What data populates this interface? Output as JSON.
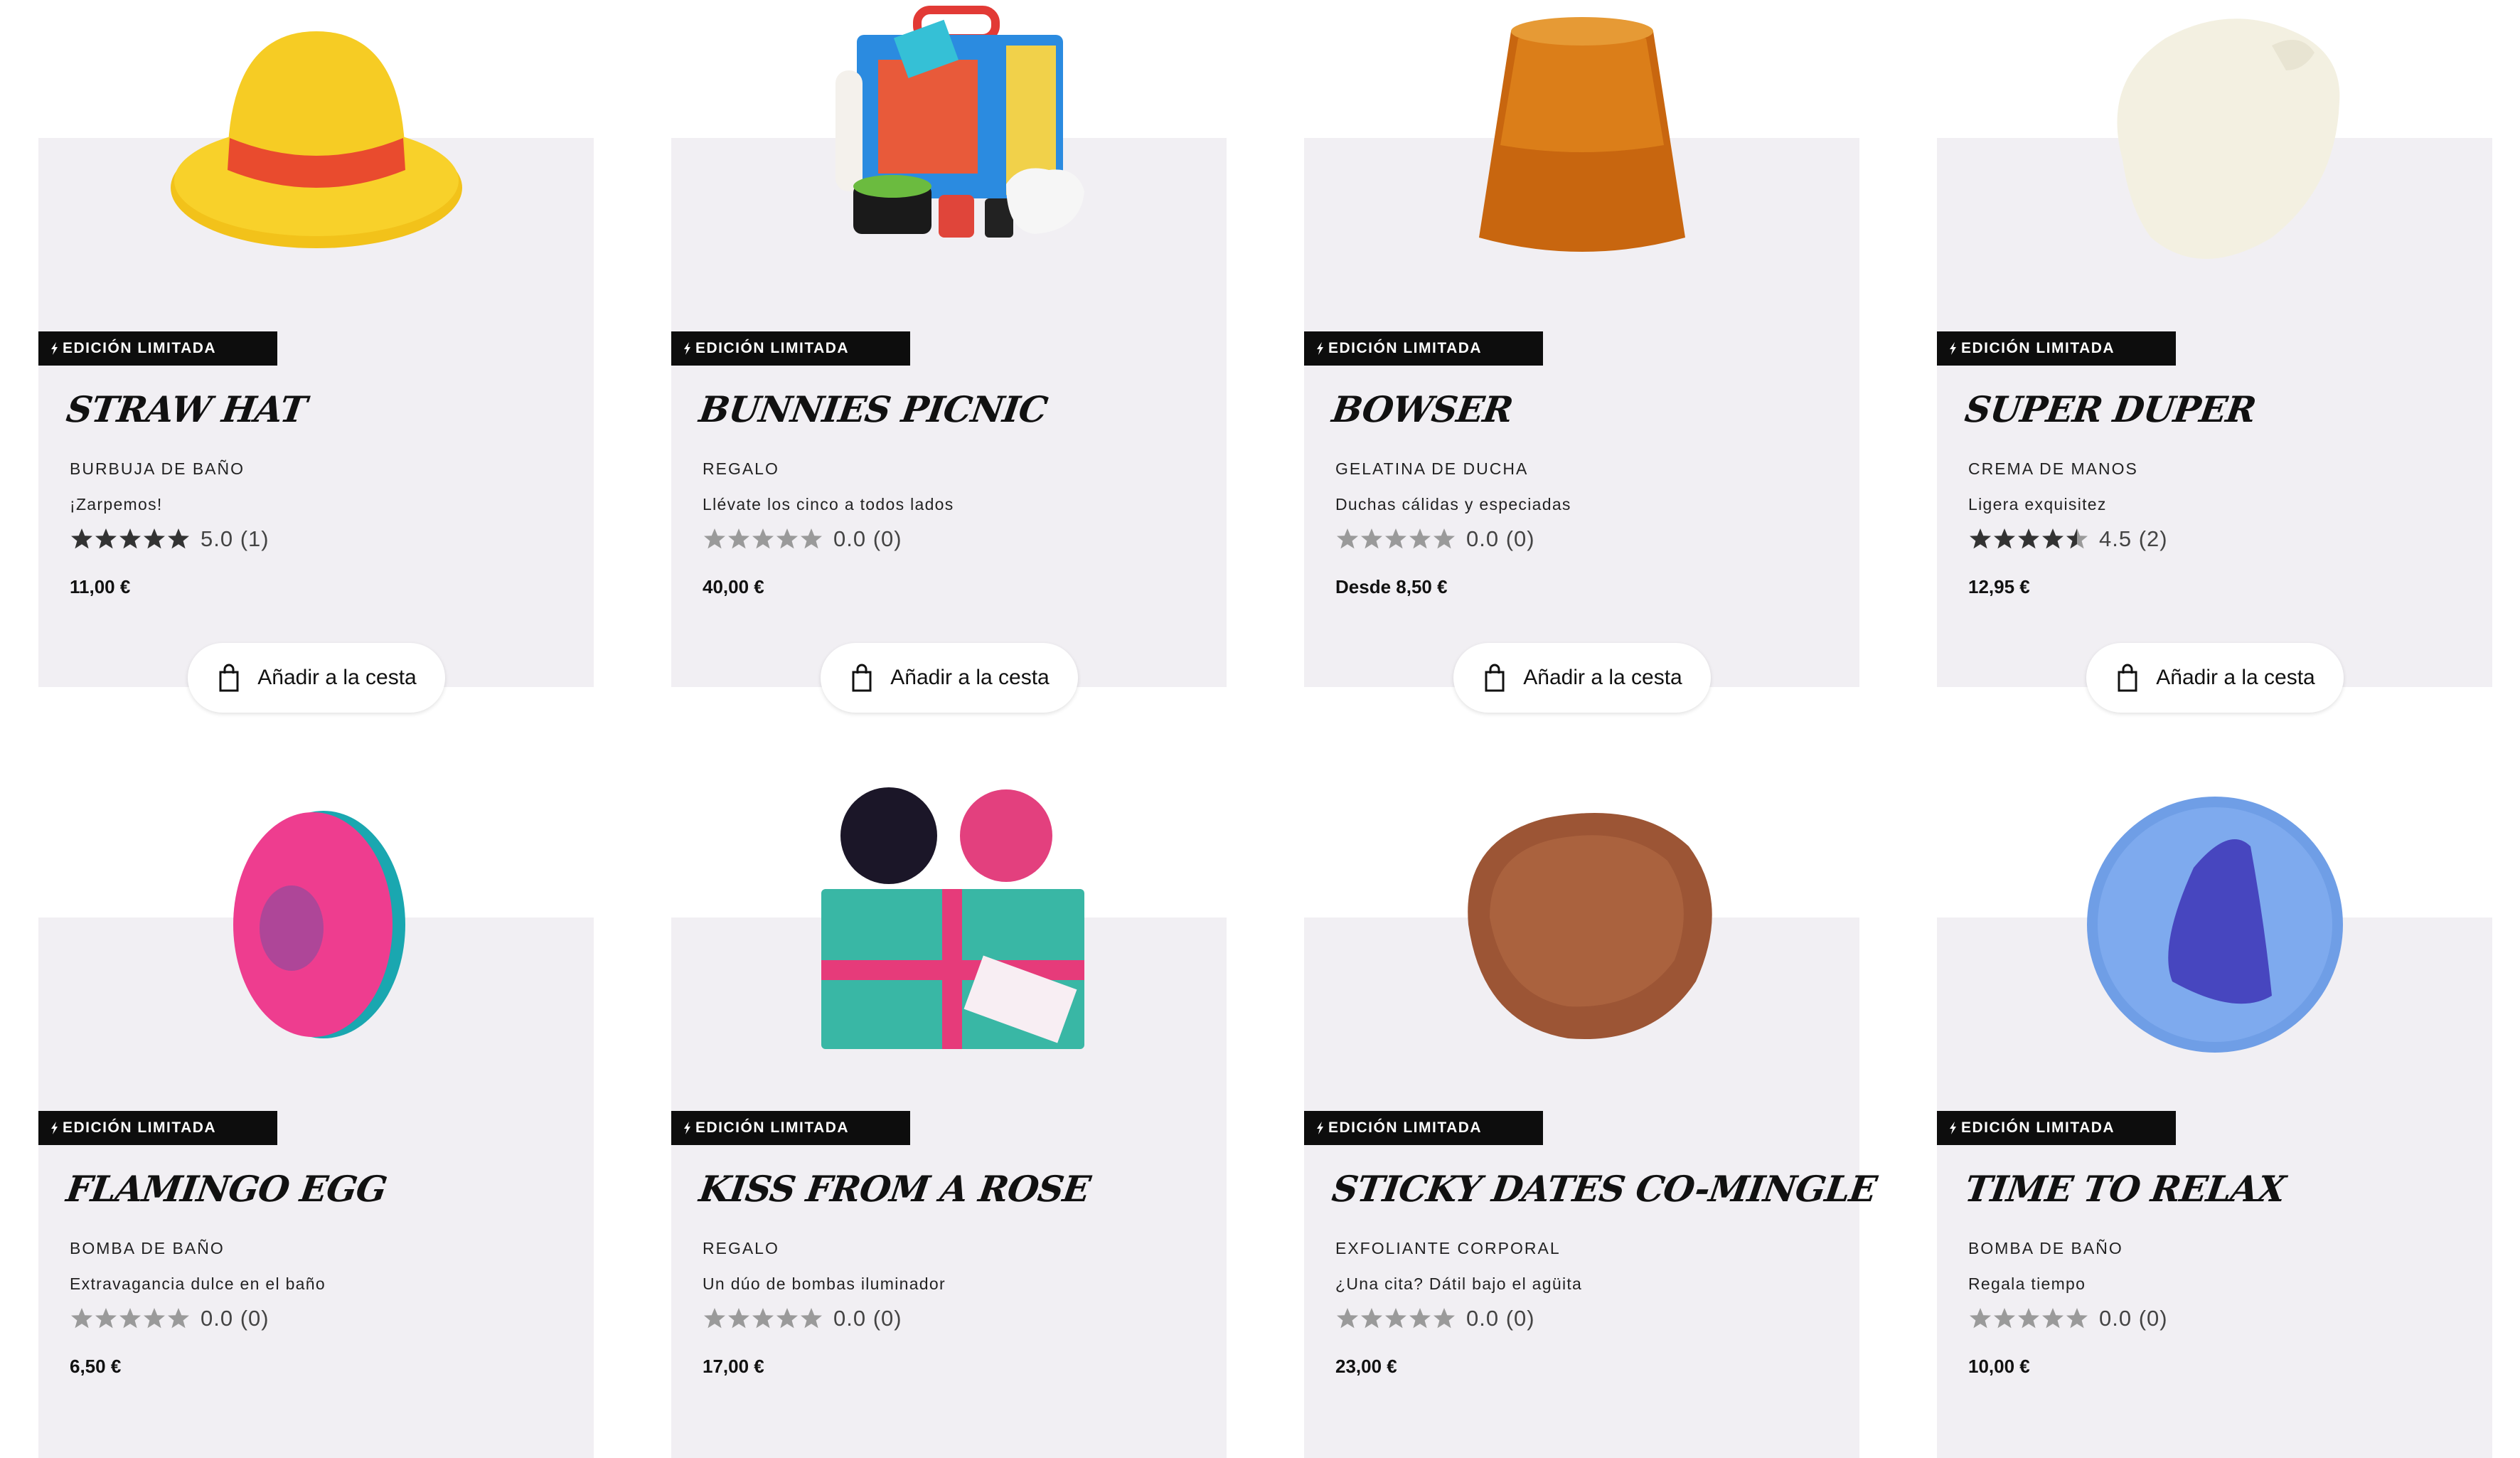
{
  "products": [
    {
      "badge": "EDICIÓN LIMITADA",
      "name": "STRAW HAT",
      "category": "BURBUJA DE BAÑO",
      "tagline": "¡Zarpemos!",
      "rating_value": 5.0,
      "rating_text": "5.0 (1)",
      "price": "11,00 €",
      "cart_label": "Añadir a la cesta",
      "image_icon": "straw-hat-bubble-image"
    },
    {
      "badge": "EDICIÓN LIMITADA",
      "name": "BUNNIES PICNIC",
      "category": "REGALO",
      "tagline": "Llévate los cinco a todos lados",
      "rating_value": 0.0,
      "rating_text": "0.0 (0)",
      "price": "40,00 €",
      "cart_label": "Añadir a la cesta",
      "image_icon": "gift-box-image"
    },
    {
      "badge": "EDICIÓN LIMITADA",
      "name": "BOWSER",
      "category": "GELATINA DE DUCHA",
      "tagline": "Duchas cálidas y especiadas",
      "rating_value": 0.0,
      "rating_text": "0.0 (0)",
      "price": "Desde 8,50 €",
      "cart_label": "Añadir a la cesta",
      "image_icon": "shower-jelly-image"
    },
    {
      "badge": "EDICIÓN LIMITADA",
      "name": "SUPER DUPER",
      "category": "CREMA DE MANOS",
      "tagline": "Ligera exquisitez",
      "rating_value": 4.5,
      "rating_text": "4.5 (2)",
      "price": "12,95 €",
      "cart_label": "Añadir a la cesta",
      "image_icon": "hand-cream-image"
    },
    {
      "badge": "EDICIÓN LIMITADA",
      "name": "FLAMINGO EGG",
      "category": "BOMBA DE BAÑO",
      "tagline": "Extravagancia dulce en el baño",
      "rating_value": 0.0,
      "rating_text": "0.0 (0)",
      "price": "6,50 €",
      "cart_label": "",
      "image_icon": "egg-bath-bomb-image"
    },
    {
      "badge": "EDICIÓN LIMITADA",
      "name": "KISS FROM A ROSE",
      "category": "REGALO",
      "tagline": "Un dúo de bombas iluminador",
      "rating_value": 0.0,
      "rating_text": "0.0 (0)",
      "price": "17,00 €",
      "cart_label": "",
      "image_icon": "wrapped-gift-image"
    },
    {
      "badge": "EDICIÓN LIMITADA",
      "name": "STICKY DATES CO-MINGLE",
      "category": "EXFOLIANTE CORPORAL",
      "tagline": "¿Una cita? Dátil bajo el agüita",
      "rating_value": 0.0,
      "rating_text": "0.0 (0)",
      "price": "23,00 €",
      "cart_label": "",
      "image_icon": "body-scrub-image"
    },
    {
      "badge": "EDICIÓN LIMITADA",
      "name": "TIME TO RELAX",
      "category": "BOMBA DE BAÑO",
      "tagline": "Regala tiempo",
      "rating_value": 0.0,
      "rating_text": "0.0 (0)",
      "price": "10,00 €",
      "cart_label": "",
      "image_icon": "clock-bath-bomb-image"
    }
  ],
  "colors": {
    "card_bg": "#f1eff3",
    "badge_bg": "#0d0d0d",
    "star_filled": "#333333",
    "star_empty": "#9a9a9a"
  }
}
